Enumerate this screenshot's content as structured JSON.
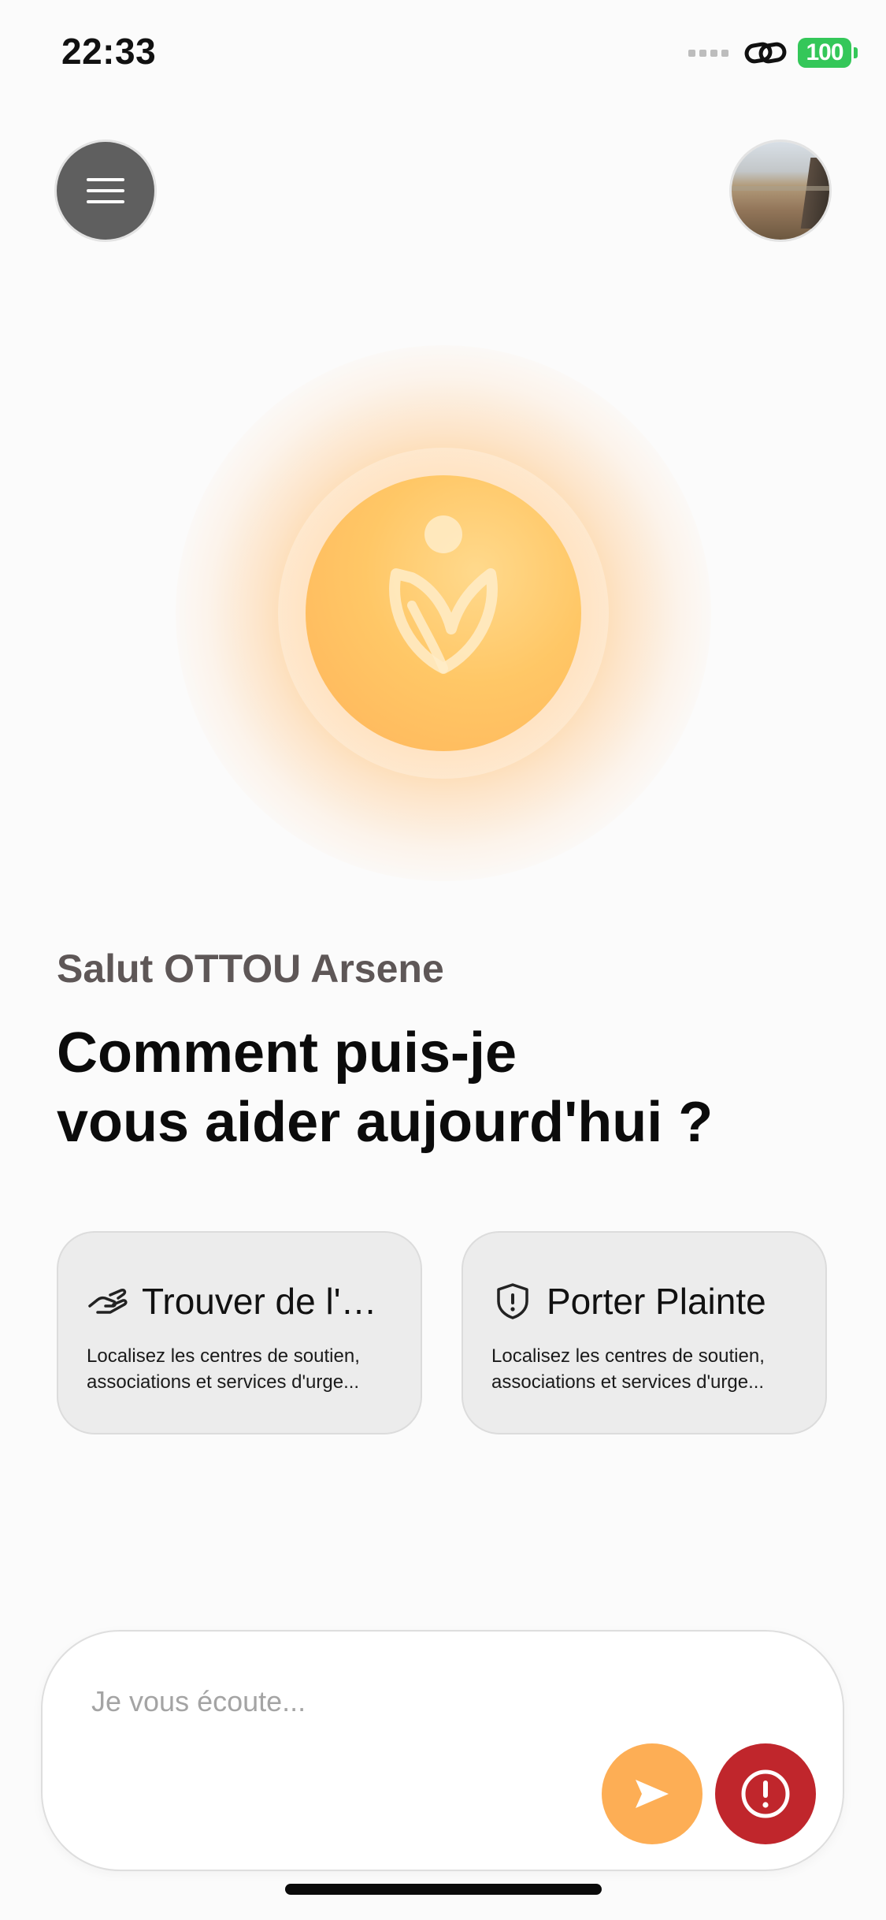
{
  "status_bar": {
    "time": "22:33",
    "battery": "100",
    "icons": [
      "signal-dots-icon",
      "link-icon",
      "battery-icon"
    ]
  },
  "header": {
    "menu_icon": "hamburger-menu-icon",
    "avatar": "profile-avatar"
  },
  "hero": {
    "logo_icon": "app-logo-icon"
  },
  "greeting": {
    "salutation": "Salut OTTOU Arsene",
    "headline_line1": "Comment puis-je",
    "headline_line2": "vous aider aujourd'hui ?"
  },
  "cards": [
    {
      "icon": "helping-hand-icon",
      "title": "Trouver de l'a...",
      "description": "Localisez les centres de soutien, associations et services d'urge..."
    },
    {
      "icon": "shield-alert-icon",
      "title": "Porter Plainte",
      "description": "Localisez les centres de soutien, associations et services d'urge..."
    }
  ],
  "composer": {
    "placeholder": "Je vous écoute...",
    "value": "",
    "send_icon": "send-icon",
    "alert_icon": "exclamation-circle-icon"
  },
  "colors": {
    "accent_orange": "#fdae55",
    "alert_red": "#c0262c",
    "battery_green": "#34c759",
    "menu_button": "#5f5f5f"
  }
}
